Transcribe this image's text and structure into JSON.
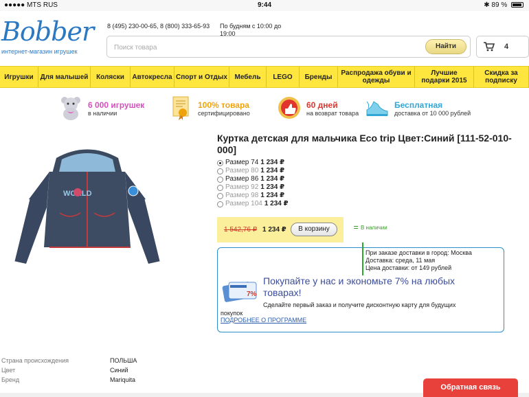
{
  "statusbar": {
    "carrier": "●●●●● MTS RUS",
    "time": "9:44",
    "battery": "89 %"
  },
  "header": {
    "logo_text": "Bobber",
    "logo_sub": "интернет-магазин игрушек",
    "phones": "8 (495) 230-00-65, 8 (800) 333-65-93",
    "hours": "По будням с 10:00 до 19:00",
    "search_placeholder": "Поиск товара",
    "search_button": "Найти",
    "cart_count": "4"
  },
  "nav": [
    {
      "label": "Игрушки",
      "w": 56
    },
    {
      "label": "Для малышей",
      "w": 76
    },
    {
      "label": "Коляски",
      "w": 58
    },
    {
      "label": "Автокресла",
      "w": 64
    },
    {
      "label": "Спорт и Отдых",
      "w": 80
    },
    {
      "label": "Мебель",
      "w": 54
    },
    {
      "label": "LEGO",
      "w": 48
    },
    {
      "label": "Бренды",
      "w": 56
    },
    {
      "label": "Распродажа обуви и одежды",
      "w": 112
    },
    {
      "label": "Лучшие подарки 2015",
      "w": 86
    },
    {
      "label": "Скидка за подписку",
      "w": 80
    }
  ],
  "advantages": [
    {
      "title": "6 000 игрушек",
      "sub": "в наличии",
      "color": "#d64fbf"
    },
    {
      "title": "100% товара",
      "sub": "сертифицировано",
      "color": "#f0a20a"
    },
    {
      "title": "60 дней",
      "sub": "на возврат товара",
      "color": "#e0342c"
    },
    {
      "title": "Бесплатная",
      "sub": "доставка от 10 000 рублей",
      "color": "#2fa6d6"
    }
  ],
  "product": {
    "title": "Куртка детская для мальчика Eco trip Цвет:Синий [111-52-010-000]",
    "sizes": [
      {
        "label": "Размер 74",
        "price": "1 234 ₽",
        "selected": true,
        "available": true
      },
      {
        "label": "Размер 80",
        "price": "1 234 ₽",
        "selected": false,
        "available": false
      },
      {
        "label": "Размер 86",
        "price": "1 234 ₽",
        "selected": false,
        "available": true
      },
      {
        "label": "Размер 92",
        "price": "1 234 ₽",
        "selected": false,
        "available": false
      },
      {
        "label": "Размер 98",
        "price": "1 234 ₽",
        "selected": false,
        "available": false
      },
      {
        "label": "Размер 104",
        "price": "1 234 ₽",
        "selected": false,
        "available": false
      }
    ],
    "old_price": "1 542,76 ₽",
    "new_price": "1 234 ₽",
    "buy_button": "В корзину",
    "stock": "В наличии"
  },
  "delivery": {
    "line1": "При заказе доставки в город: Москва",
    "line2": "Доставка: среда, 11 мая",
    "line3": "Цена доставки: от 149 рублей"
  },
  "promo": {
    "title": "Покупайте у нас и экономьте 7% на любых товарах!",
    "text": "Сделайте первый заказ и получите дисконтную карту для будущих",
    "text2": "покупок",
    "link": "ПОДРОБНЕЕ О ПРОГРАММЕ",
    "card_text": "7%"
  },
  "specs": [
    {
      "key": "Страна происхождения",
      "value": "ПОЛЬША"
    },
    {
      "key": "Цвет",
      "value": "Синий"
    },
    {
      "key": "Бренд",
      "value": "Mariquita"
    }
  ],
  "feedback_button": "Обратная связь"
}
